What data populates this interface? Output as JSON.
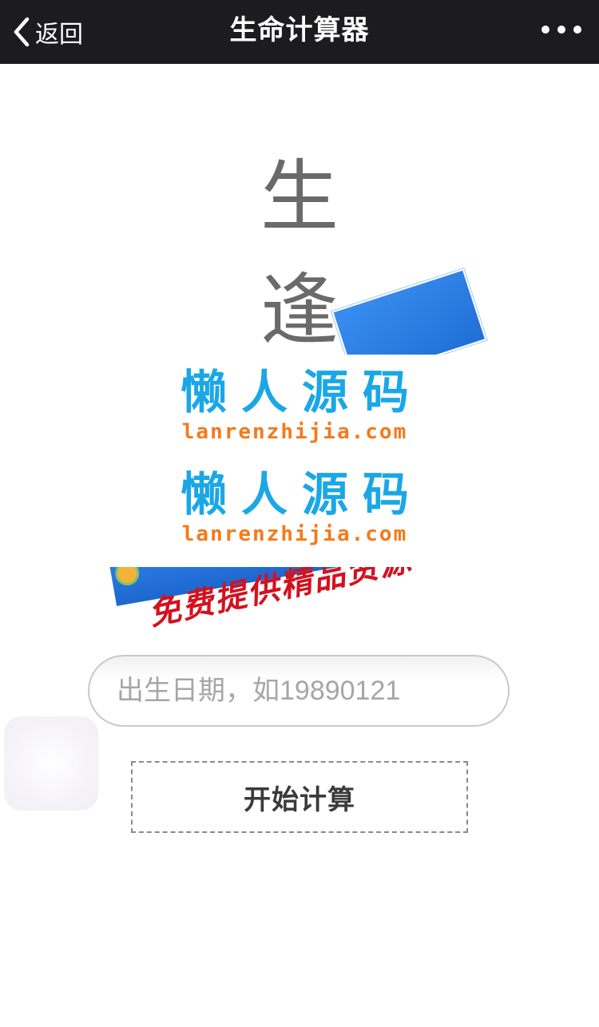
{
  "nav": {
    "back_label": "返回",
    "title": "生命计算器",
    "more_icon": "more-horizontal-icon"
  },
  "poster": {
    "char1": "生",
    "char2": "逢",
    "slogan": "免费提供精品资源"
  },
  "watermark": {
    "line1_cn": "懒人源码",
    "line1_en": "lanrenzhijia.com",
    "line2_cn": "懒人源码",
    "line2_en": "lanrenzhijia.com"
  },
  "form": {
    "birth_date_placeholder": "出生日期，如19890121",
    "birth_date_value": "",
    "start_label": "开始计算"
  },
  "colors": {
    "navbar_bg": "#1c1c1e",
    "watermark_cn": "#1ba7e6",
    "watermark_en": "#f47a1b",
    "slogan": "#d3111f"
  }
}
